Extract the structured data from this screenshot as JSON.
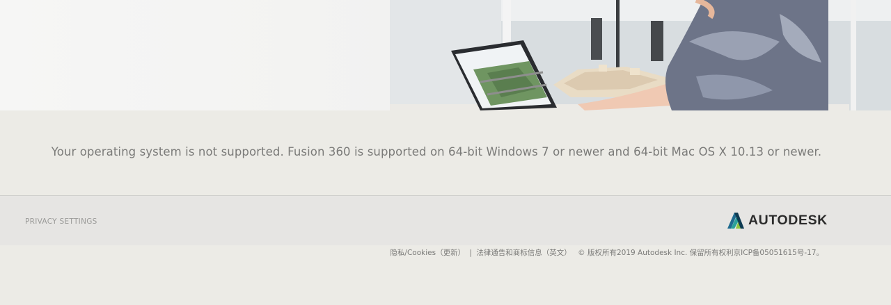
{
  "hero": {
    "image_description": "photo-woman-at-laptop"
  },
  "message": {
    "text": "Your operating system is not supported. Fusion 360 is supported on 64-bit Windows 7 or newer and 64-bit Mac OS X 10.13 or newer."
  },
  "footer": {
    "privacy_settings": "PRIVACY SETTINGS",
    "logo_text": "AUTODESK",
    "logo_icon": "autodesk-a-icon",
    "legal": {
      "privacy_cookies": "隐私/Cookies（更新）",
      "separator": "|",
      "legal_notices": "法律通告和商标信息（英文）",
      "copyright": "© 版权所有2019 Autodesk Inc. 保留所有权利京ICP备05051615号-17。"
    }
  },
  "colors": {
    "background": "#ecebe6",
    "footer_bar": "#e6e5e3",
    "message_text": "#7b7b79",
    "logo_text": "#2b2b2b"
  }
}
